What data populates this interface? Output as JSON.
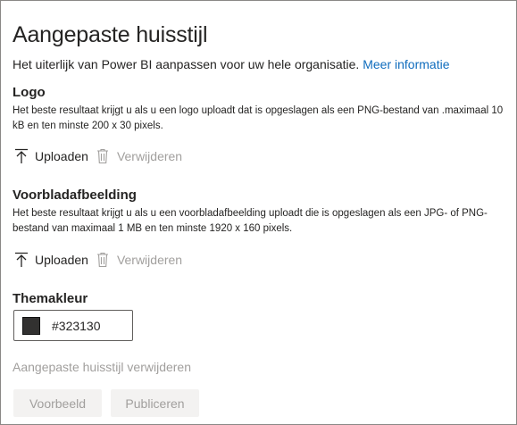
{
  "header": {
    "title": "Aangepaste huisstijl",
    "subtitle": "Het uiterlijk van Power BI aanpassen voor uw hele organisatie.",
    "more_link": "Meer informatie"
  },
  "logo": {
    "heading": "Logo",
    "description": "Het beste resultaat krijgt u als u een logo uploadt dat is opgeslagen als een PNG-bestand van .maximaal 10 kB en ten minste 200 x 30 pixels.",
    "upload_label": "Uploaden",
    "remove_label": "Verwijderen"
  },
  "cover": {
    "heading": "Voorbladafbeelding",
    "description": "Het beste resultaat krijgt u als u een voorbladafbeelding uploadt die is opgeslagen als een JPG- of PNG-bestand van maximaal 1 MB en ten minste 1920 x 160 pixels.",
    "upload_label": "Uploaden",
    "remove_label": "Verwijderen"
  },
  "theme": {
    "heading": "Themakleur",
    "color_value": "#323130",
    "swatch_color": "#323130"
  },
  "footer": {
    "remove_branding_label": "Aangepaste huisstijl verwijderen",
    "preview_label": "Voorbeeld",
    "publish_label": "Publiceren"
  },
  "colors": {
    "link": "#0f6cbd",
    "disabled_text": "#a19f9d",
    "disabled_button_bg": "#f3f2f1"
  }
}
